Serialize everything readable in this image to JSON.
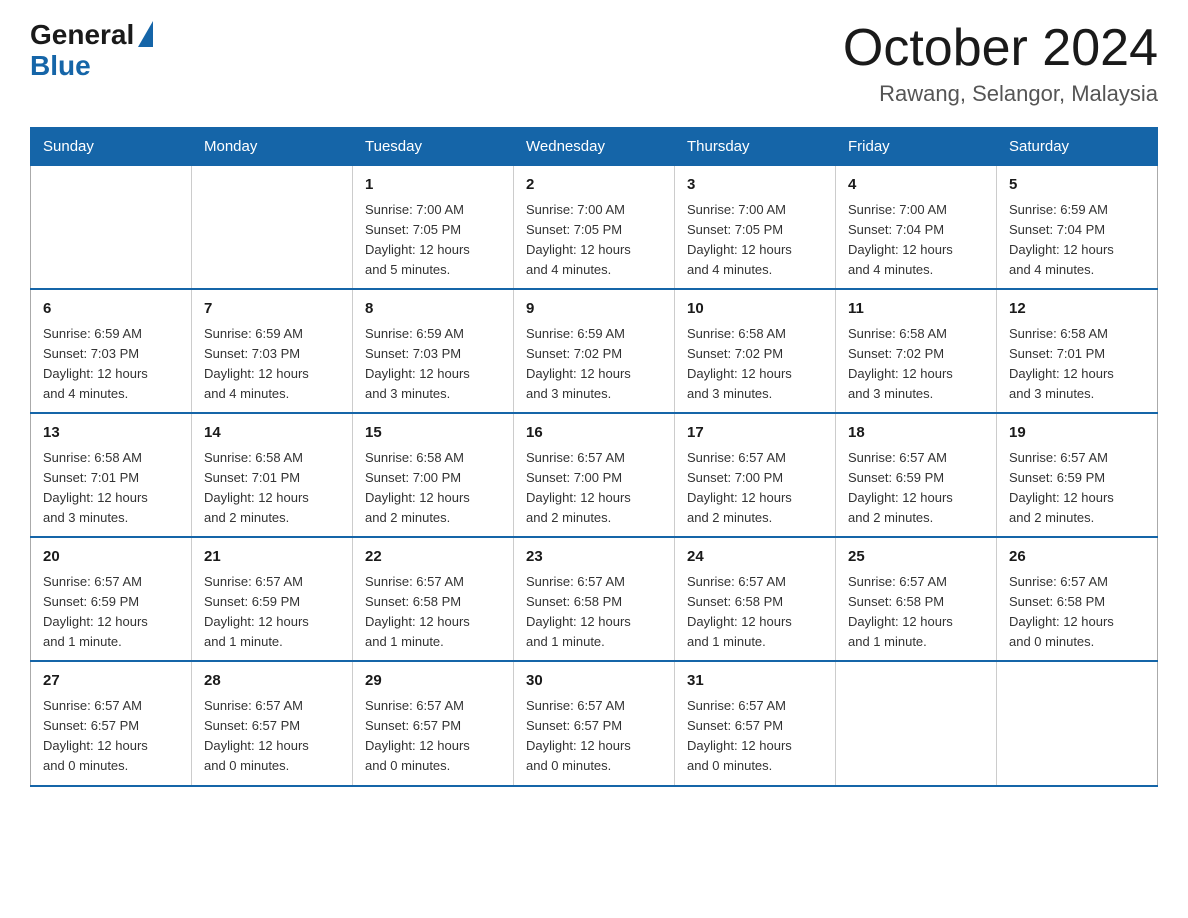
{
  "logo": {
    "general": "General",
    "blue": "Blue"
  },
  "title": "October 2024",
  "subtitle": "Rawang, Selangor, Malaysia",
  "calendar": {
    "headers": [
      "Sunday",
      "Monday",
      "Tuesday",
      "Wednesday",
      "Thursday",
      "Friday",
      "Saturday"
    ],
    "weeks": [
      [
        {
          "day": "",
          "info": ""
        },
        {
          "day": "",
          "info": ""
        },
        {
          "day": "1",
          "info": "Sunrise: 7:00 AM\nSunset: 7:05 PM\nDaylight: 12 hours\nand 5 minutes."
        },
        {
          "day": "2",
          "info": "Sunrise: 7:00 AM\nSunset: 7:05 PM\nDaylight: 12 hours\nand 4 minutes."
        },
        {
          "day": "3",
          "info": "Sunrise: 7:00 AM\nSunset: 7:05 PM\nDaylight: 12 hours\nand 4 minutes."
        },
        {
          "day": "4",
          "info": "Sunrise: 7:00 AM\nSunset: 7:04 PM\nDaylight: 12 hours\nand 4 minutes."
        },
        {
          "day": "5",
          "info": "Sunrise: 6:59 AM\nSunset: 7:04 PM\nDaylight: 12 hours\nand 4 minutes."
        }
      ],
      [
        {
          "day": "6",
          "info": "Sunrise: 6:59 AM\nSunset: 7:03 PM\nDaylight: 12 hours\nand 4 minutes."
        },
        {
          "day": "7",
          "info": "Sunrise: 6:59 AM\nSunset: 7:03 PM\nDaylight: 12 hours\nand 4 minutes."
        },
        {
          "day": "8",
          "info": "Sunrise: 6:59 AM\nSunset: 7:03 PM\nDaylight: 12 hours\nand 3 minutes."
        },
        {
          "day": "9",
          "info": "Sunrise: 6:59 AM\nSunset: 7:02 PM\nDaylight: 12 hours\nand 3 minutes."
        },
        {
          "day": "10",
          "info": "Sunrise: 6:58 AM\nSunset: 7:02 PM\nDaylight: 12 hours\nand 3 minutes."
        },
        {
          "day": "11",
          "info": "Sunrise: 6:58 AM\nSunset: 7:02 PM\nDaylight: 12 hours\nand 3 minutes."
        },
        {
          "day": "12",
          "info": "Sunrise: 6:58 AM\nSunset: 7:01 PM\nDaylight: 12 hours\nand 3 minutes."
        }
      ],
      [
        {
          "day": "13",
          "info": "Sunrise: 6:58 AM\nSunset: 7:01 PM\nDaylight: 12 hours\nand 3 minutes."
        },
        {
          "day": "14",
          "info": "Sunrise: 6:58 AM\nSunset: 7:01 PM\nDaylight: 12 hours\nand 2 minutes."
        },
        {
          "day": "15",
          "info": "Sunrise: 6:58 AM\nSunset: 7:00 PM\nDaylight: 12 hours\nand 2 minutes."
        },
        {
          "day": "16",
          "info": "Sunrise: 6:57 AM\nSunset: 7:00 PM\nDaylight: 12 hours\nand 2 minutes."
        },
        {
          "day": "17",
          "info": "Sunrise: 6:57 AM\nSunset: 7:00 PM\nDaylight: 12 hours\nand 2 minutes."
        },
        {
          "day": "18",
          "info": "Sunrise: 6:57 AM\nSunset: 6:59 PM\nDaylight: 12 hours\nand 2 minutes."
        },
        {
          "day": "19",
          "info": "Sunrise: 6:57 AM\nSunset: 6:59 PM\nDaylight: 12 hours\nand 2 minutes."
        }
      ],
      [
        {
          "day": "20",
          "info": "Sunrise: 6:57 AM\nSunset: 6:59 PM\nDaylight: 12 hours\nand 1 minute."
        },
        {
          "day": "21",
          "info": "Sunrise: 6:57 AM\nSunset: 6:59 PM\nDaylight: 12 hours\nand 1 minute."
        },
        {
          "day": "22",
          "info": "Sunrise: 6:57 AM\nSunset: 6:58 PM\nDaylight: 12 hours\nand 1 minute."
        },
        {
          "day": "23",
          "info": "Sunrise: 6:57 AM\nSunset: 6:58 PM\nDaylight: 12 hours\nand 1 minute."
        },
        {
          "day": "24",
          "info": "Sunrise: 6:57 AM\nSunset: 6:58 PM\nDaylight: 12 hours\nand 1 minute."
        },
        {
          "day": "25",
          "info": "Sunrise: 6:57 AM\nSunset: 6:58 PM\nDaylight: 12 hours\nand 1 minute."
        },
        {
          "day": "26",
          "info": "Sunrise: 6:57 AM\nSunset: 6:58 PM\nDaylight: 12 hours\nand 0 minutes."
        }
      ],
      [
        {
          "day": "27",
          "info": "Sunrise: 6:57 AM\nSunset: 6:57 PM\nDaylight: 12 hours\nand 0 minutes."
        },
        {
          "day": "28",
          "info": "Sunrise: 6:57 AM\nSunset: 6:57 PM\nDaylight: 12 hours\nand 0 minutes."
        },
        {
          "day": "29",
          "info": "Sunrise: 6:57 AM\nSunset: 6:57 PM\nDaylight: 12 hours\nand 0 minutes."
        },
        {
          "day": "30",
          "info": "Sunrise: 6:57 AM\nSunset: 6:57 PM\nDaylight: 12 hours\nand 0 minutes."
        },
        {
          "day": "31",
          "info": "Sunrise: 6:57 AM\nSunset: 6:57 PM\nDaylight: 12 hours\nand 0 minutes."
        },
        {
          "day": "",
          "info": ""
        },
        {
          "day": "",
          "info": ""
        }
      ]
    ]
  }
}
